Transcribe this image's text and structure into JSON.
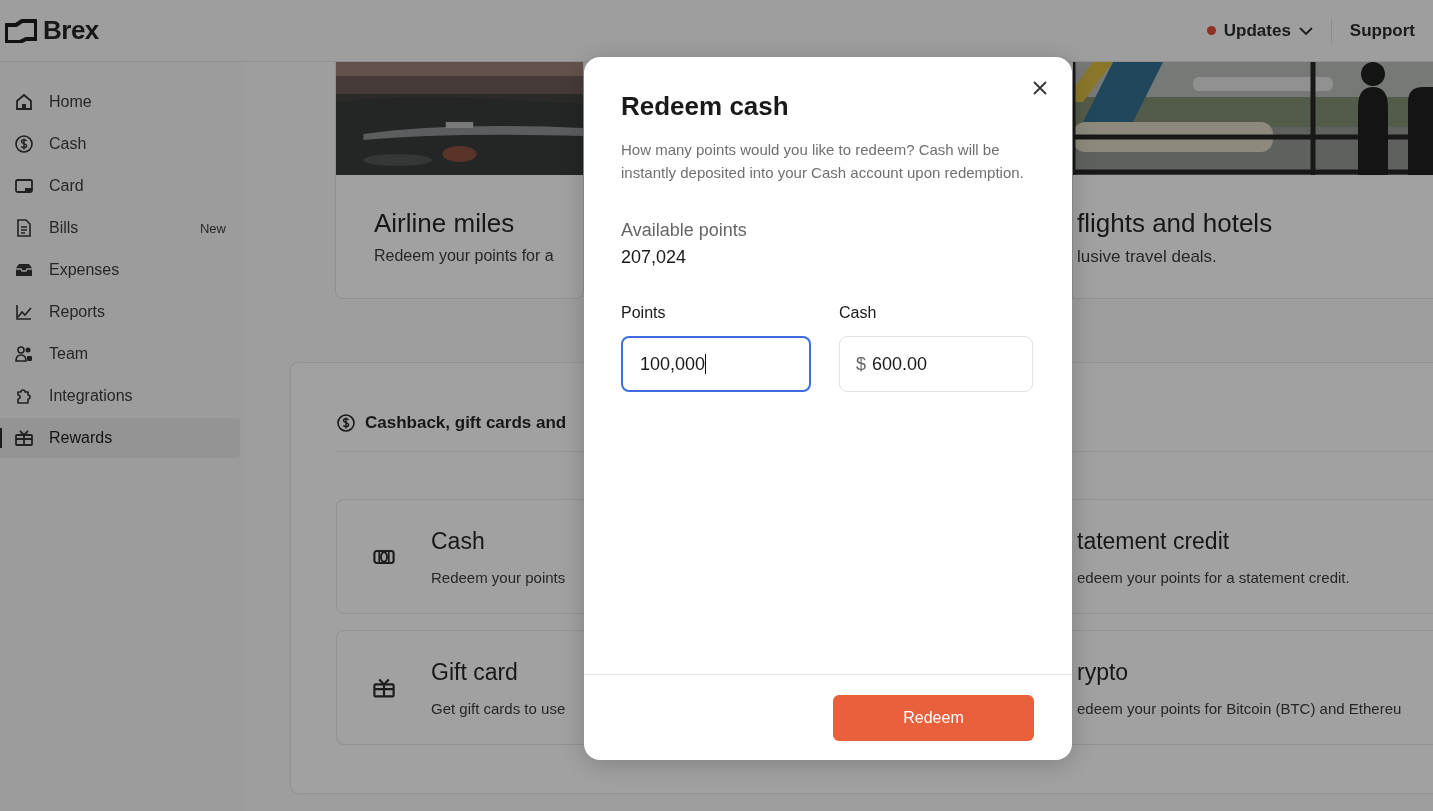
{
  "header": {
    "logo": "Brex",
    "updates": {
      "label": "Updates",
      "unread": true
    },
    "support": "Support"
  },
  "sidebar": {
    "items": [
      {
        "label": "Home",
        "selected": false
      },
      {
        "label": "Cash",
        "selected": false
      },
      {
        "label": "Card",
        "selected": false
      },
      {
        "label": "Bills",
        "selected": false,
        "badge": "New"
      },
      {
        "label": "Expenses",
        "selected": false
      },
      {
        "label": "Reports",
        "selected": false
      },
      {
        "label": "Team",
        "selected": false
      },
      {
        "label": "Integrations",
        "selected": false
      },
      {
        "label": "Rewards",
        "selected": true
      }
    ]
  },
  "travel_cards": [
    {
      "title": "Airline miles",
      "description": "Redeem your points for a"
    },
    {
      "title": "flights and hotels",
      "description": "lusive travel deals."
    }
  ],
  "section": {
    "title": "Cashback, gift cards and",
    "options": [
      {
        "title": "Cash",
        "description": "Redeem your points"
      },
      {
        "title": "tatement credit",
        "description": "edeem your points for a statement credit."
      },
      {
        "title": "Gift card",
        "description": "Get gift cards to use"
      },
      {
        "title": "rypto",
        "description": "edeem your points for Bitcoin (BTC) and Ethereu"
      }
    ]
  },
  "modal": {
    "title": "Redeem cash",
    "description": "How many points would you like to redeem? Cash will be instantly deposited into your Cash account upon redemption.",
    "available_label": "Available points",
    "available_value": "207,024",
    "fields": [
      {
        "label": "Points",
        "value": "100,000",
        "focused": true
      },
      {
        "label": "Cash",
        "prefix": "$",
        "value": "600.00",
        "focused": false
      }
    ],
    "button": "Redeem"
  }
}
